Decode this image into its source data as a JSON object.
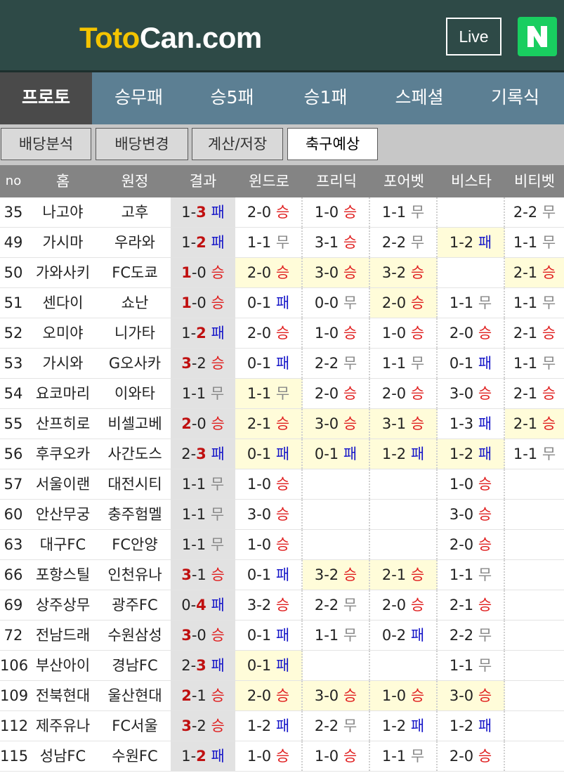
{
  "header": {
    "logo_part1": "Toto",
    "logo_part2": "Can.com",
    "live_label": "Live",
    "n_label": "N",
    "colors": {
      "bg": "#2e4a47",
      "logo_accent": "#f4c400",
      "n_green": "#19ce60"
    }
  },
  "tabs": [
    {
      "label": "프로토",
      "active": true
    },
    {
      "label": "승무패",
      "active": false
    },
    {
      "label": "승5패",
      "active": false
    },
    {
      "label": "승1패",
      "active": false
    },
    {
      "label": "스페셜",
      "active": false
    },
    {
      "label": "기록식",
      "active": false
    }
  ],
  "subtabs": [
    {
      "label": "배당분석",
      "active": false
    },
    {
      "label": "배당변경",
      "active": false
    },
    {
      "label": "계산/저장",
      "active": false
    },
    {
      "label": "축구예상",
      "active": true
    }
  ],
  "table": {
    "columns": [
      "no",
      "홈",
      "원정",
      "결과",
      "윈드로",
      "프리딕",
      "포어벳",
      "비스타",
      "비티벳"
    ],
    "rows": [
      {
        "no": "35",
        "home": "나고야",
        "away": "고후",
        "result": {
          "h": "1",
          "a": "3",
          "out": "패"
        },
        "preds": [
          {
            "s": "2-0",
            "o": "승"
          },
          {
            "s": "1-0",
            "o": "승"
          },
          {
            "s": "1-1",
            "o": "무"
          },
          null,
          {
            "s": "2-2",
            "o": "무"
          }
        ]
      },
      {
        "no": "49",
        "home": "가시마",
        "away": "우라와",
        "result": {
          "h": "1",
          "a": "2",
          "out": "패"
        },
        "preds": [
          {
            "s": "1-1",
            "o": "무"
          },
          {
            "s": "3-1",
            "o": "승"
          },
          {
            "s": "2-2",
            "o": "무"
          },
          {
            "s": "1-2",
            "o": "패",
            "hl": true
          },
          {
            "s": "1-1",
            "o": "무"
          }
        ]
      },
      {
        "no": "50",
        "home": "가와사키",
        "away": "FC도쿄",
        "result": {
          "h": "1",
          "a": "0",
          "out": "승"
        },
        "preds": [
          {
            "s": "2-0",
            "o": "승",
            "hl": true
          },
          {
            "s": "3-0",
            "o": "승",
            "hl": true
          },
          {
            "s": "3-2",
            "o": "승",
            "hl": true
          },
          null,
          {
            "s": "2-1",
            "o": "승",
            "hl": true
          }
        ]
      },
      {
        "no": "51",
        "home": "센다이",
        "away": "쇼난",
        "result": {
          "h": "1",
          "a": "0",
          "out": "승"
        },
        "preds": [
          {
            "s": "0-1",
            "o": "패"
          },
          {
            "s": "0-0",
            "o": "무"
          },
          {
            "s": "2-0",
            "o": "승",
            "hl": true
          },
          {
            "s": "1-1",
            "o": "무"
          },
          {
            "s": "1-1",
            "o": "무"
          }
        ]
      },
      {
        "no": "52",
        "home": "오미야",
        "away": "니가타",
        "result": {
          "h": "1",
          "a": "2",
          "out": "패"
        },
        "preds": [
          {
            "s": "2-0",
            "o": "승"
          },
          {
            "s": "1-0",
            "o": "승"
          },
          {
            "s": "1-0",
            "o": "승"
          },
          {
            "s": "2-0",
            "o": "승"
          },
          {
            "s": "2-1",
            "o": "승"
          }
        ]
      },
      {
        "no": "53",
        "home": "가시와",
        "away": "G오사카",
        "result": {
          "h": "3",
          "a": "2",
          "out": "승"
        },
        "preds": [
          {
            "s": "0-1",
            "o": "패"
          },
          {
            "s": "2-2",
            "o": "무"
          },
          {
            "s": "1-1",
            "o": "무"
          },
          {
            "s": "0-1",
            "o": "패"
          },
          {
            "s": "1-1",
            "o": "무"
          }
        ]
      },
      {
        "no": "54",
        "home": "요코마리",
        "away": "이와타",
        "result": {
          "h": "1",
          "a": "1",
          "out": "무"
        },
        "preds": [
          {
            "s": "1-1",
            "o": "무",
            "hl": true
          },
          {
            "s": "2-0",
            "o": "승"
          },
          {
            "s": "2-0",
            "o": "승"
          },
          {
            "s": "3-0",
            "o": "승"
          },
          {
            "s": "2-1",
            "o": "승"
          }
        ]
      },
      {
        "no": "55",
        "home": "산프히로",
        "away": "비셀고베",
        "result": {
          "h": "2",
          "a": "0",
          "out": "승"
        },
        "preds": [
          {
            "s": "2-1",
            "o": "승",
            "hl": true
          },
          {
            "s": "3-0",
            "o": "승",
            "hl": true
          },
          {
            "s": "3-1",
            "o": "승",
            "hl": true
          },
          {
            "s": "1-3",
            "o": "패"
          },
          {
            "s": "2-1",
            "o": "승",
            "hl": true
          }
        ]
      },
      {
        "no": "56",
        "home": "후쿠오카",
        "away": "사간도스",
        "result": {
          "h": "2",
          "a": "3",
          "out": "패"
        },
        "preds": [
          {
            "s": "0-1",
            "o": "패",
            "hl": true
          },
          {
            "s": "0-1",
            "o": "패",
            "hl": true
          },
          {
            "s": "1-2",
            "o": "패",
            "hl": true
          },
          {
            "s": "1-2",
            "o": "패",
            "hl": true
          },
          {
            "s": "1-1",
            "o": "무"
          }
        ]
      },
      {
        "no": "57",
        "home": "서울이랜",
        "away": "대전시티",
        "result": {
          "h": "1",
          "a": "1",
          "out": "무"
        },
        "preds": [
          {
            "s": "1-0",
            "o": "승"
          },
          null,
          null,
          {
            "s": "1-0",
            "o": "승"
          },
          null
        ]
      },
      {
        "no": "60",
        "home": "안산무궁",
        "away": "충주험멜",
        "result": {
          "h": "1",
          "a": "1",
          "out": "무"
        },
        "preds": [
          {
            "s": "3-0",
            "o": "승"
          },
          null,
          null,
          {
            "s": "3-0",
            "o": "승"
          },
          null
        ]
      },
      {
        "no": "63",
        "home": "대구FC",
        "away": "FC안양",
        "result": {
          "h": "1",
          "a": "1",
          "out": "무"
        },
        "preds": [
          {
            "s": "1-0",
            "o": "승"
          },
          null,
          null,
          {
            "s": "2-0",
            "o": "승"
          },
          null
        ]
      },
      {
        "no": "66",
        "home": "포항스틸",
        "away": "인천유나",
        "result": {
          "h": "3",
          "a": "1",
          "out": "승"
        },
        "preds": [
          {
            "s": "0-1",
            "o": "패"
          },
          {
            "s": "3-2",
            "o": "승",
            "hl": true
          },
          {
            "s": "2-1",
            "o": "승",
            "hl": true
          },
          {
            "s": "1-1",
            "o": "무"
          },
          null
        ]
      },
      {
        "no": "69",
        "home": "상주상무",
        "away": "광주FC",
        "result": {
          "h": "0",
          "a": "4",
          "out": "패"
        },
        "preds": [
          {
            "s": "3-2",
            "o": "승"
          },
          {
            "s": "2-2",
            "o": "무"
          },
          {
            "s": "2-0",
            "o": "승"
          },
          {
            "s": "2-1",
            "o": "승"
          },
          null
        ]
      },
      {
        "no": "72",
        "home": "전남드래",
        "away": "수원삼성",
        "result": {
          "h": "3",
          "a": "0",
          "out": "승"
        },
        "preds": [
          {
            "s": "0-1",
            "o": "패"
          },
          {
            "s": "1-1",
            "o": "무"
          },
          {
            "s": "0-2",
            "o": "패"
          },
          {
            "s": "2-2",
            "o": "무"
          },
          null
        ]
      },
      {
        "no": "106",
        "home": "부산아이",
        "away": "경남FC",
        "result": {
          "h": "2",
          "a": "3",
          "out": "패"
        },
        "preds": [
          {
            "s": "0-1",
            "o": "패",
            "hl": true
          },
          null,
          null,
          {
            "s": "1-1",
            "o": "무"
          },
          null
        ]
      },
      {
        "no": "109",
        "home": "전북현대",
        "away": "울산현대",
        "result": {
          "h": "2",
          "a": "1",
          "out": "승"
        },
        "preds": [
          {
            "s": "2-0",
            "o": "승",
            "hl": true
          },
          {
            "s": "3-0",
            "o": "승",
            "hl": true
          },
          {
            "s": "1-0",
            "o": "승",
            "hl": true
          },
          {
            "s": "3-0",
            "o": "승",
            "hl": true
          },
          null
        ]
      },
      {
        "no": "112",
        "home": "제주유나",
        "away": "FC서울",
        "result": {
          "h": "3",
          "a": "2",
          "out": "승"
        },
        "preds": [
          {
            "s": "1-2",
            "o": "패"
          },
          {
            "s": "2-2",
            "o": "무"
          },
          {
            "s": "1-2",
            "o": "패"
          },
          {
            "s": "1-2",
            "o": "패"
          },
          null
        ]
      },
      {
        "no": "115",
        "home": "성남FC",
        "away": "수원FC",
        "result": {
          "h": "1",
          "a": "2",
          "out": "패"
        },
        "preds": [
          {
            "s": "1-0",
            "o": "승"
          },
          {
            "s": "1-0",
            "o": "승"
          },
          {
            "s": "1-1",
            "o": "무"
          },
          {
            "s": "2-0",
            "o": "승"
          },
          null
        ]
      }
    ]
  }
}
